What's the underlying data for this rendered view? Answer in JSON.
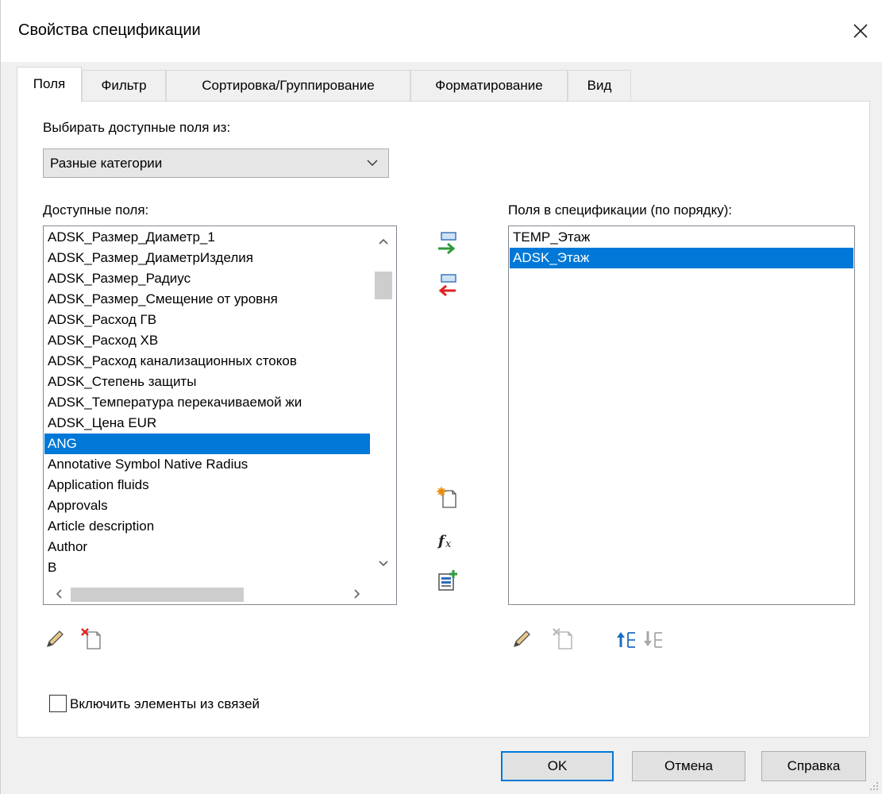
{
  "window": {
    "title": "Свойства спецификации"
  },
  "tabs": [
    {
      "label": "Поля",
      "active": true
    },
    {
      "label": "Фильтр",
      "active": false
    },
    {
      "label": "Сортировка/Группирование",
      "active": false
    },
    {
      "label": "Форматирование",
      "active": false
    },
    {
      "label": "Вид",
      "active": false
    }
  ],
  "source": {
    "label": "Выбирать доступные поля из:",
    "selected": "Разные категории"
  },
  "available": {
    "label": "Доступные поля:",
    "items": [
      "ADSK_Размер_Диаметр_1",
      "ADSK_Размер_ДиаметрИзделия",
      "ADSK_Размер_Радиус",
      "ADSK_Размер_Смещение от уровня",
      "ADSK_Расход ГВ",
      "ADSK_Расход ХВ",
      "ADSK_Расход канализационных стоков",
      "ADSK_Степень защиты",
      "ADSK_Температура перекачиваемой жи",
      "ADSK_Цена EUR",
      "ANG",
      "Annotative Symbol Native Radius",
      "Application fluids",
      "Approvals",
      "Article description",
      "Author",
      "B"
    ],
    "selected_index": 10
  },
  "scheduled": {
    "label": "Поля в спецификации (по порядку):",
    "items": [
      "TEMP_Этаж",
      "ADSK_Этаж"
    ],
    "selected_index": 1
  },
  "include_links": {
    "label": "Включить элементы из связей",
    "checked": false
  },
  "buttons": {
    "ok": "OK",
    "cancel": "Отмена",
    "help": "Справка"
  },
  "icons": {
    "close": "close-icon",
    "add_field": "add-field-icon",
    "remove_field": "remove-field-icon",
    "new_parameter": "new-parameter-icon",
    "formula": "formula-icon",
    "combine": "combine-parameters-icon",
    "edit": "edit-pencil-icon",
    "delete": "delete-parameter-icon",
    "move_up": "move-up-icon",
    "move_down": "move-down-icon"
  },
  "colors": {
    "selection": "#0078d7",
    "add_arrow": "#2e9a3a",
    "remove_arrow": "#e02020"
  }
}
